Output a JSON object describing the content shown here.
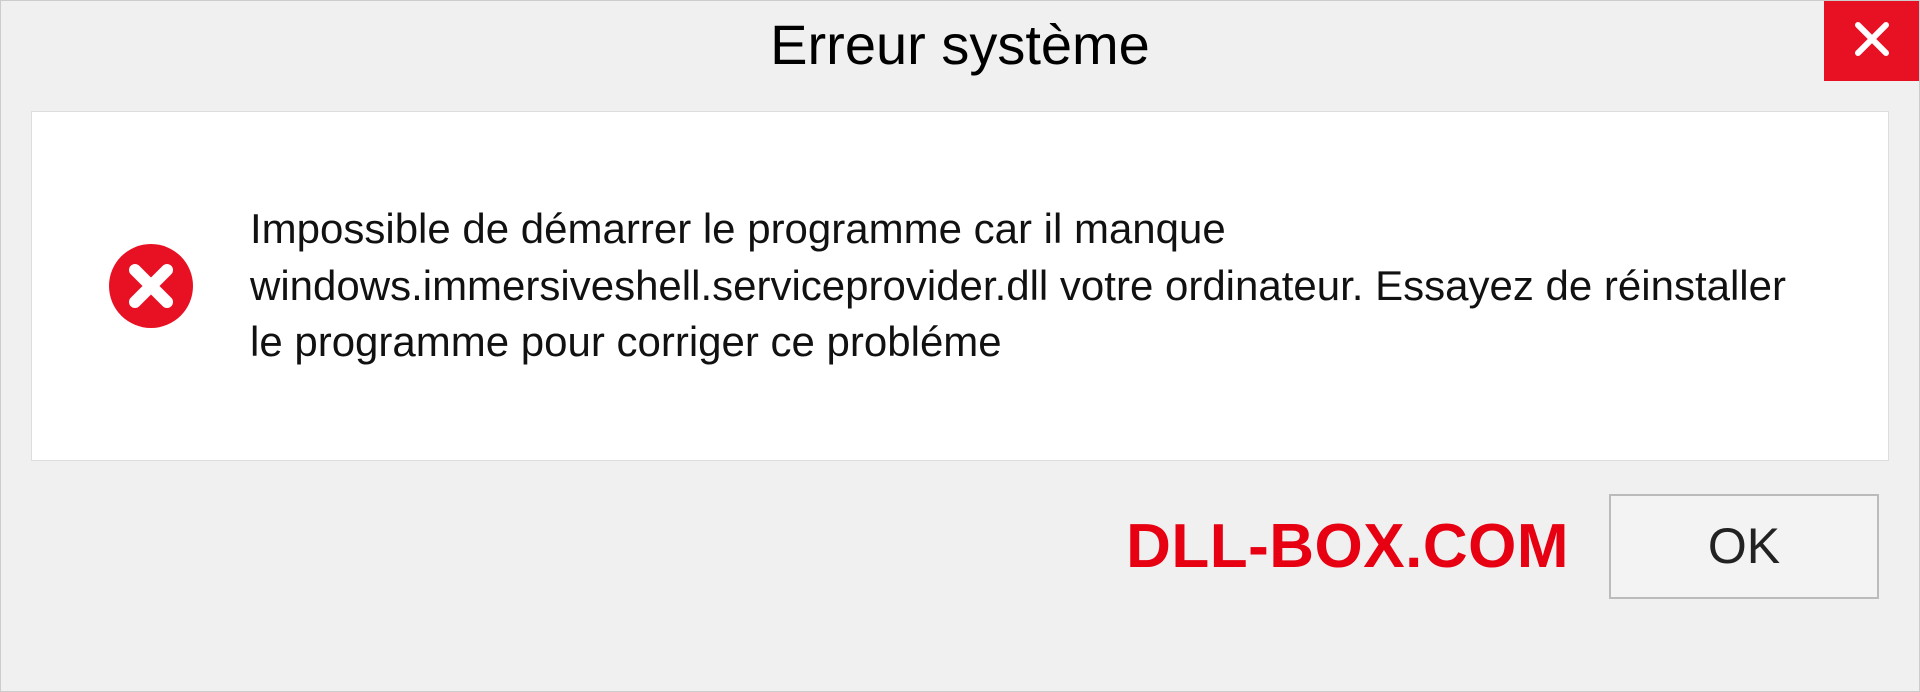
{
  "dialog": {
    "title": "Erreur système",
    "message": "Impossible de démarrer le programme car il manque windows.immersiveshell.serviceprovider.dll votre ordinateur. Essayez de réinstaller le programme pour corriger ce probléme",
    "ok_label": "OK"
  },
  "watermark": "DLL-BOX.COM",
  "colors": {
    "close_button_bg": "#e81123",
    "error_icon": "#e81123",
    "watermark_text": "#e60012"
  }
}
